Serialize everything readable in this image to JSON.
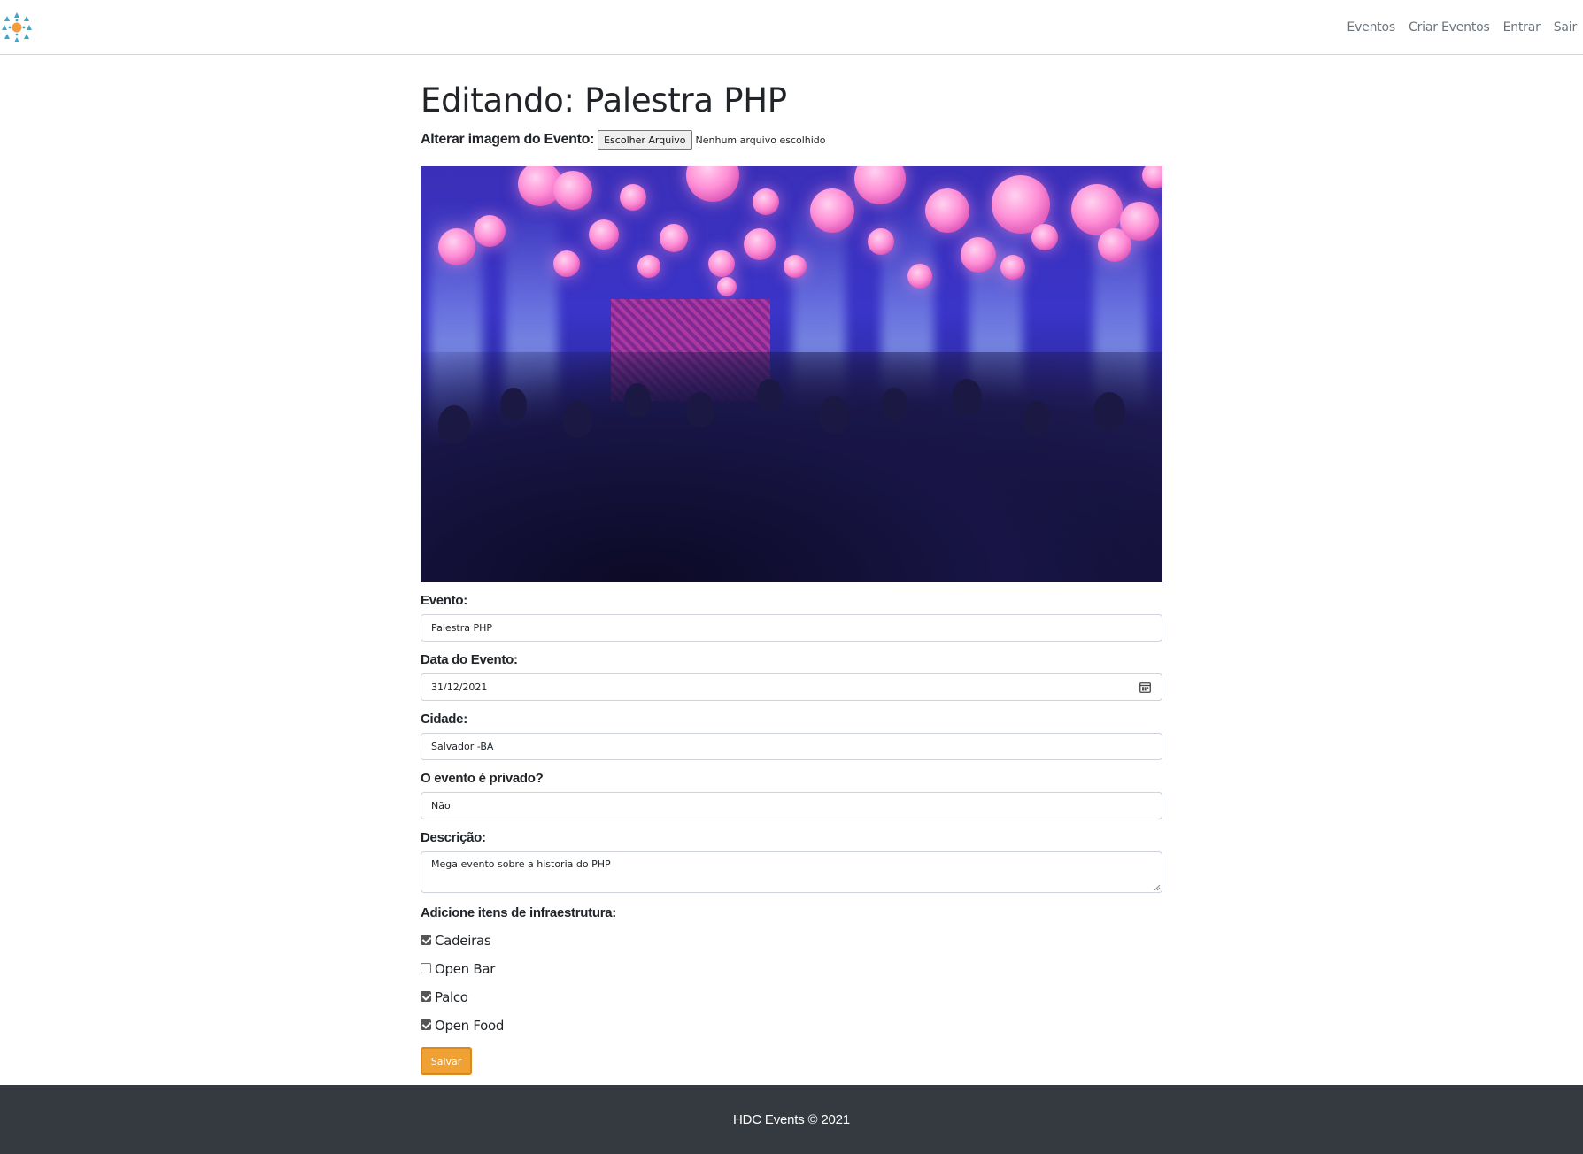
{
  "navbar": {
    "logo_icon": "people-network-logo-icon",
    "links": [
      "Eventos",
      "Criar Eventos",
      "Entrar",
      "Sair"
    ]
  },
  "main": {
    "title": "Editando: Palestra PHP",
    "image_field": {
      "label": "Alterar imagem do Evento:",
      "button_label": "Escolher Arquivo",
      "status": "Nenhum arquivo escolhido"
    },
    "fields": {
      "event": {
        "label": "Evento:",
        "value": "Palestra PHP"
      },
      "date": {
        "label": "Data do Evento:",
        "value": "31/12/2021"
      },
      "city": {
        "label": "Cidade:",
        "value": "Salvador -BA"
      },
      "private": {
        "label": "O evento é privado?",
        "value": "Não"
      },
      "description": {
        "label": "Descrição:",
        "value": "Mega evento sobre a historia do PHP"
      }
    },
    "infrastructure": {
      "label": "Adicione itens de infraestrutura:",
      "items": [
        {
          "label": "Cadeiras",
          "checked": true
        },
        {
          "label": "Open Bar",
          "checked": false
        },
        {
          "label": "Palco",
          "checked": true
        },
        {
          "label": "Open Food",
          "checked": true
        }
      ]
    },
    "save_label": "Salvar"
  },
  "footer": {
    "text": "HDC Events © 2021"
  },
  "colors": {
    "accent": "#f0a134",
    "footer_bg": "#343a40",
    "nav_text": "#6c757d"
  }
}
